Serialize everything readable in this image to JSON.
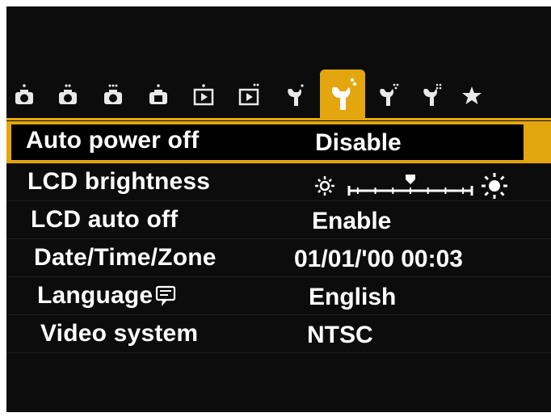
{
  "tabs": [
    {
      "icon": "camera-tab-1-icon",
      "active": false
    },
    {
      "icon": "camera-tab-2-icon",
      "active": false
    },
    {
      "icon": "camera-tab-3-icon",
      "active": false
    },
    {
      "icon": "camera-tab-4-icon",
      "active": false
    },
    {
      "icon": "playback-tab-1-icon",
      "active": false
    },
    {
      "icon": "playback-tab-2-icon",
      "active": false
    },
    {
      "icon": "setup-tab-1-icon",
      "active": false
    },
    {
      "icon": "setup-tab-2-icon",
      "active": true
    },
    {
      "icon": "setup-tab-3-icon",
      "active": false
    },
    {
      "icon": "setup-tab-4-icon",
      "active": false
    },
    {
      "icon": "my-menu-star-icon",
      "active": false
    }
  ],
  "menu": {
    "items": [
      {
        "label": "Auto power off",
        "value": "Disable",
        "selected": true
      },
      {
        "label": "LCD brightness",
        "value": "",
        "brightness_level": 4,
        "brightness_steps": 7
      },
      {
        "label": "LCD auto off",
        "value": "Enable"
      },
      {
        "label": "Date/Time/Zone",
        "value": "01/01/'00 00:03"
      },
      {
        "label": "Language",
        "value": "English"
      },
      {
        "label": "Video system",
        "value": "NTSC"
      }
    ]
  },
  "colors": {
    "accent": "#e3a60f",
    "background": "#0c0c0c",
    "text": "#ffffff"
  }
}
